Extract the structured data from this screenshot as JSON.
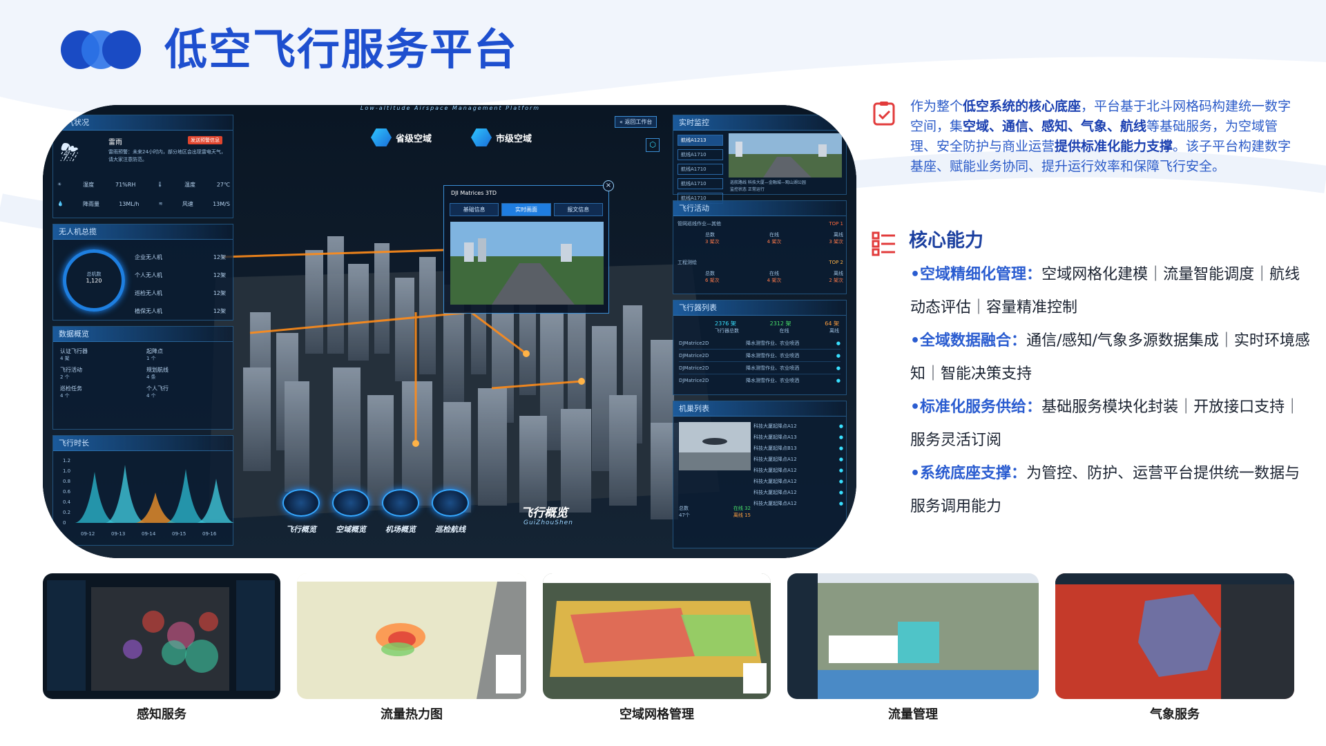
{
  "page": {
    "title": "低空飞行服务平台"
  },
  "intro": {
    "parts": [
      {
        "text": "作为整个",
        "bold": false
      },
      {
        "text": "低空系统的核心底座",
        "bold": true
      },
      {
        "text": "，平台基于北斗网格码构建统一数字空间，集",
        "bold": false
      },
      {
        "text": "空域、通信、感知、气象、航线",
        "bold": true
      },
      {
        "text": "等基础服务，为空域管理、安全防护与商业运营",
        "bold": false
      },
      {
        "text": "提供标准化能力支撑",
        "bold": true
      },
      {
        "text": "。该子平台构建数字基座、赋能业务协同、提升运行效率和保障飞行安全。",
        "bold": false
      }
    ]
  },
  "core": {
    "title": "核心能力",
    "items": [
      {
        "key": "•空域精细化管理：",
        "value": "空域网格化建模｜流量智能调度｜航线动态评估｜容量精准控制"
      },
      {
        "key": "•全域数据融合：",
        "value": "通信/感知/气象多源数据集成｜实时环境感知｜智能决策支持"
      },
      {
        "key": "•标准化服务供给：",
        "value": "基础服务模块化封装｜开放接口支持｜服务灵活订阅"
      },
      {
        "key": "•系统底座支撑：",
        "value": "为管控、防护、运营平台提供统一数据与服务调用能力"
      }
    ]
  },
  "dashboard": {
    "subtitle": "Low-altitude Airspace Management Platform",
    "region_prov": "省级空域",
    "region_city": "市级空域",
    "return_btn": "返回工作台",
    "weather": {
      "title": "天气状况",
      "condition": "雷雨",
      "alert": "发送预警信息",
      "desc": "雷雨预警：未来24小时内，部分地区会出现雷电天气，请大家注意防范。",
      "humidity_l": "湿度",
      "humidity_v": "71%RH",
      "temp_l": "温度",
      "temp_v": "27℃",
      "rain_l": "降雨量",
      "rain_v": "13ML/h",
      "wind_l": "风速",
      "wind_v": "13M/S"
    },
    "uav": {
      "title": "无人机总揽",
      "total_l": "总机数",
      "total_v": "1,120",
      "rows": [
        {
          "label": "企业无人机",
          "value": "12架"
        },
        {
          "label": "个人无人机",
          "value": "12架"
        },
        {
          "label": "巡检无人机",
          "value": "12架"
        },
        {
          "label": "植保无人机",
          "value": "12架"
        }
      ]
    },
    "data": {
      "title": "数据概览",
      "cells": [
        {
          "label": "认证飞行器",
          "value": "4 架"
        },
        {
          "label": "起降点",
          "value": "1 个"
        },
        {
          "label": "飞行活动",
          "value": "2 个"
        },
        {
          "label": "规划航线",
          "value": "4 条"
        },
        {
          "label": "巡检任务",
          "value": "4 个"
        },
        {
          "label": "个人飞行",
          "value": "4 个"
        }
      ]
    },
    "duration": {
      "title": "飞行时长",
      "yticks": [
        "1.2",
        "1.0",
        "0.8",
        "0.6",
        "0.4",
        "0.2",
        "0"
      ],
      "dates": [
        "09-12",
        "09-13",
        "09-14",
        "09-15",
        "09-16"
      ]
    },
    "popup": {
      "title": "DJI Matrices 3TD",
      "tabs": [
        "基础信息",
        "实时画面",
        "报文信息"
      ]
    },
    "monitor": {
      "title": "实时监控",
      "lines": [
        "航线A1213",
        "航线A1710",
        "航线A1710",
        "航线A1710",
        "航线A1710"
      ],
      "route": "巡航路线  科技大厦—金融城—观山湖公园",
      "status": "监控状态  正常运行"
    },
    "activity": {
      "title": "飞行活动",
      "items": [
        {
          "name": "管网巡线作业—其他",
          "rank": "TOP 1",
          "c1": "总数",
          "v1": "3 架次",
          "c2": "在线",
          "v2": "4 架次",
          "c3": "离线",
          "v3": "3 架次"
        },
        {
          "name": "工程测绘",
          "rank": "TOP 2",
          "c1": "总数",
          "v1": "6 架次",
          "c2": "在线",
          "v2": "4 架次",
          "c3": "离线",
          "v3": "2 架次"
        }
      ]
    },
    "aircraft": {
      "title": "飞行器列表",
      "total": "2376 架",
      "online": "2312 架",
      "offline": "64 架",
      "total_l": "飞行器总数",
      "online_l": "在线",
      "offline_l": "离线",
      "rows": [
        {
          "model": "DJMatrice2D",
          "task": "降水测雪作业、农业喷洒"
        },
        {
          "model": "DJMatrice2D",
          "task": "降水测雪作业、农业喷洒"
        },
        {
          "model": "DJMatrice2D",
          "task": "降水测雪作业、农业喷洒"
        },
        {
          "model": "DJMatrice2D",
          "task": "降水测雪作业、农业喷洒"
        }
      ]
    },
    "hangar": {
      "title": "机巢列表",
      "rows": [
        "科技大厦起降点A12",
        "科技大厦起降点A13",
        "科技大厦起降点B13",
        "科技大厦起降点A12",
        "科技大厦起降点A12",
        "科技大厦起降点A12",
        "科技大厦起降点A12",
        "科技大厦起降点A12"
      ],
      "total_l": "总数",
      "total_v": "47个",
      "online": "在线 32",
      "offline": "离线 15"
    },
    "nav": {
      "big_title": "飞行概览",
      "big_sub": "GuiZhouShen",
      "items": [
        "飞行概览",
        "空域概览",
        "机场概览",
        "巡检航线"
      ]
    }
  },
  "thumbs": [
    "感知服务",
    "流量热力图",
    "空域网格管理",
    "流量管理",
    "气象服务"
  ],
  "colors": {
    "brand": "#1e4fcf",
    "accent": "#2a5cd0",
    "dark_ui": "#07111d",
    "highlight": "#39e0ff",
    "alert": "#e0452e"
  }
}
